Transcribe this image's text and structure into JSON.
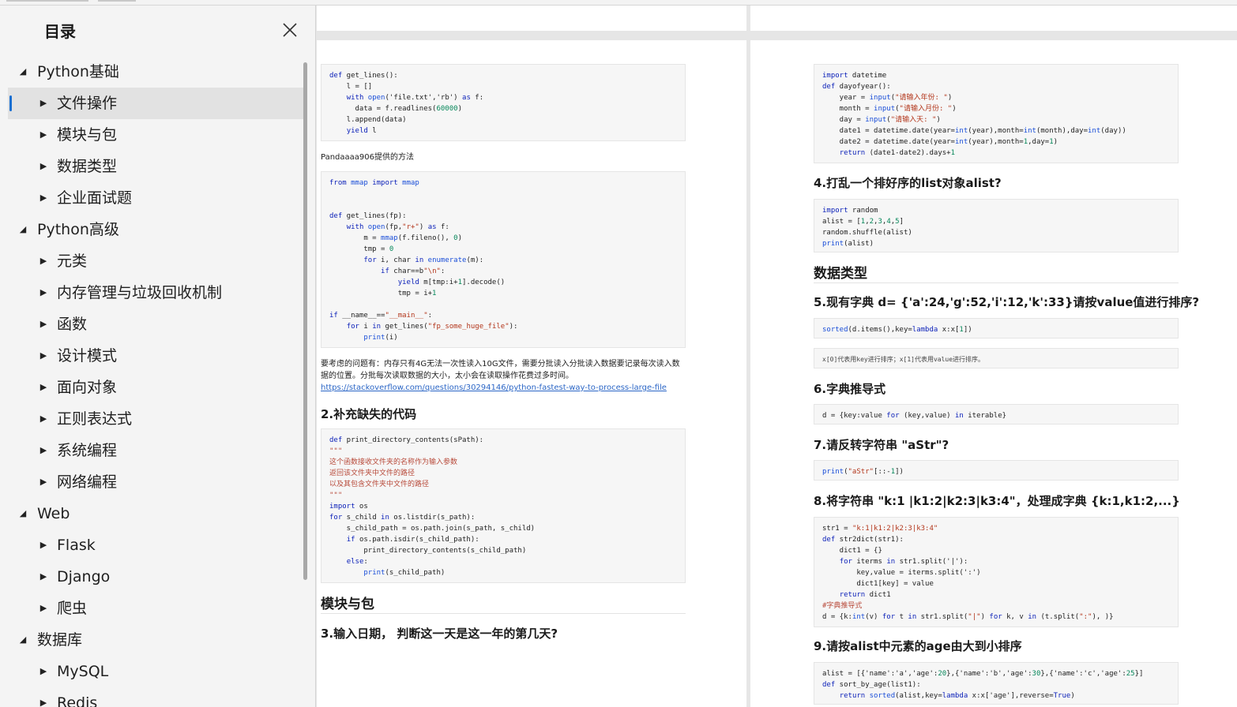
{
  "sidebar": {
    "title": "目录",
    "close_icon": "close-icon",
    "items": [
      {
        "label": "Python基础",
        "level": 0,
        "expanded": true
      },
      {
        "label": "文件操作",
        "level": 1,
        "selected": true
      },
      {
        "label": "模块与包",
        "level": 1
      },
      {
        "label": "数据类型",
        "level": 1
      },
      {
        "label": "企业面试题",
        "level": 1
      },
      {
        "label": "Python高级",
        "level": 0,
        "expanded": true
      },
      {
        "label": "元类",
        "level": 1
      },
      {
        "label": "内存管理与垃圾回收机制",
        "level": 1
      },
      {
        "label": "函数",
        "level": 1
      },
      {
        "label": "设计模式",
        "level": 1
      },
      {
        "label": "面向对象",
        "level": 1
      },
      {
        "label": "正则表达式",
        "level": 1
      },
      {
        "label": "系统编程",
        "level": 1
      },
      {
        "label": "网络编程",
        "level": 1
      },
      {
        "label": "Web",
        "level": 0,
        "expanded": true
      },
      {
        "label": "Flask",
        "level": 1
      },
      {
        "label": "Django",
        "level": 1
      },
      {
        "label": "爬虫",
        "level": 1
      },
      {
        "label": "数据库",
        "level": 0,
        "expanded": true
      },
      {
        "label": "MySQL",
        "level": 1
      },
      {
        "label": "Redis",
        "level": 1
      }
    ]
  },
  "left_page": {
    "code1": [
      "def get_lines():",
      "    l = []",
      "    with open('file.txt','rb') as f:",
      "      data = f.readlines(60000)",
      "    l.append(data)",
      "    yield l"
    ],
    "note1": "Pandaaaa906提供的方法",
    "code2": [
      "from mmap import mmap",
      "",
      "",
      "def get_lines(fp):",
      "    with open(fp,\"r+\") as f:",
      "        m = mmap(f.fileno(), 0)",
      "        tmp = 0",
      "        for i, char in enumerate(m):",
      "            if char==b\"\\n\":",
      "                yield m[tmp:i+1].decode()",
      "                tmp = i+1",
      "",
      "if __name__==\"__main__\":",
      "    for i in get_lines(\"fp_some_huge_file\"):",
      "        print(i)"
    ],
    "para1_line1": "要考虑的问题有：内存只有4G无法一次性读入10G文件，需要分批读入分批读入数据要记录每次读入数",
    "para1_line2": "据的位置。分批每次读取数据的大小，太小会在读取操作花费过多时间。",
    "link": "https://stackoverflow.com/questions/30294146/python-fastest-way-to-process-large-file",
    "h_2": "2.补充缺失的代码",
    "code3": [
      "def print_directory_contents(sPath):",
      "\"\"\"",
      "这个函数接收文件夹的名称作为输入参数",
      "返回该文件夹中文件的路径",
      "以及其包含文件夹中文件的路径",
      "\"\"\"",
      "import os",
      "for s_child in os.listdir(s_path):",
      "    s_child_path = os.path.join(s_path, s_child)",
      "    if os.path.isdir(s_child_path):",
      "        print_directory_contents(s_child_path)",
      "    else:",
      "        print(s_child_path)"
    ],
    "section_modules": "模块与包",
    "h_3": "3.输入日期， 判断这一天是这一年的第几天?"
  },
  "right_page": {
    "code1": [
      "import datetime",
      "def dayofyear():",
      "    year = input(\"请输入年份: \")",
      "    month = input(\"请输入月份: \")",
      "    day = input(\"请输入天: \")",
      "    date1 = datetime.date(year=int(year),month=int(month),day=int(day))",
      "    date2 = datetime.date(year=int(year),month=1,day=1)",
      "    return (date1-date2).days+1"
    ],
    "h_4": "4.打乱一个排好序的list对象alist?",
    "code2": [
      "import random",
      "alist = [1,2,3,4,5]",
      "random.shuffle(alist)",
      "print(alist)"
    ],
    "section_types": "数据类型",
    "h_5": "5.现有字典 d= {'a':24,'g':52,'i':12,'k':33}请按value值进行排序?",
    "code3": "sorted(d.items(),key=lambda x:x[1])",
    "note": "x[0]代表用key进行排序；x[1]代表用value进行排序。",
    "h_6": "6.字典推导式",
    "code4": "d = {key:value for (key,value) in iterable}",
    "h_7": "7.请反转字符串 \"aStr\"?",
    "code5": "print(\"aStr\"[::-1])",
    "h_8": "8.将字符串 \"k:1 |k1:2|k2:3|k3:4\"，处理成字典 {k:1,k1:2,...}",
    "code6": [
      "str1 = \"k:1|k1:2|k2:3|k3:4\"",
      "def str2dict(str1):",
      "    dict1 = {}",
      "    for iterms in str1.split('|'):",
      "        key,value = iterms.split(':')",
      "        dict1[key] = value",
      "    return dict1",
      "#字典推导式",
      "d = {k:int(v) for t in str1.split(\"|\") for k, v in (t.split(\":\"), )}"
    ],
    "h_9": "9.请按alist中元素的age由大到小排序",
    "code7": [
      "alist = [{'name':'a','age':20},{'name':'b','age':30},{'name':'c','age':25}]",
      "def sort_by_age(list1):",
      "    return sorted(alist,key=lambda x:x['age'],reverse=True)"
    ]
  }
}
